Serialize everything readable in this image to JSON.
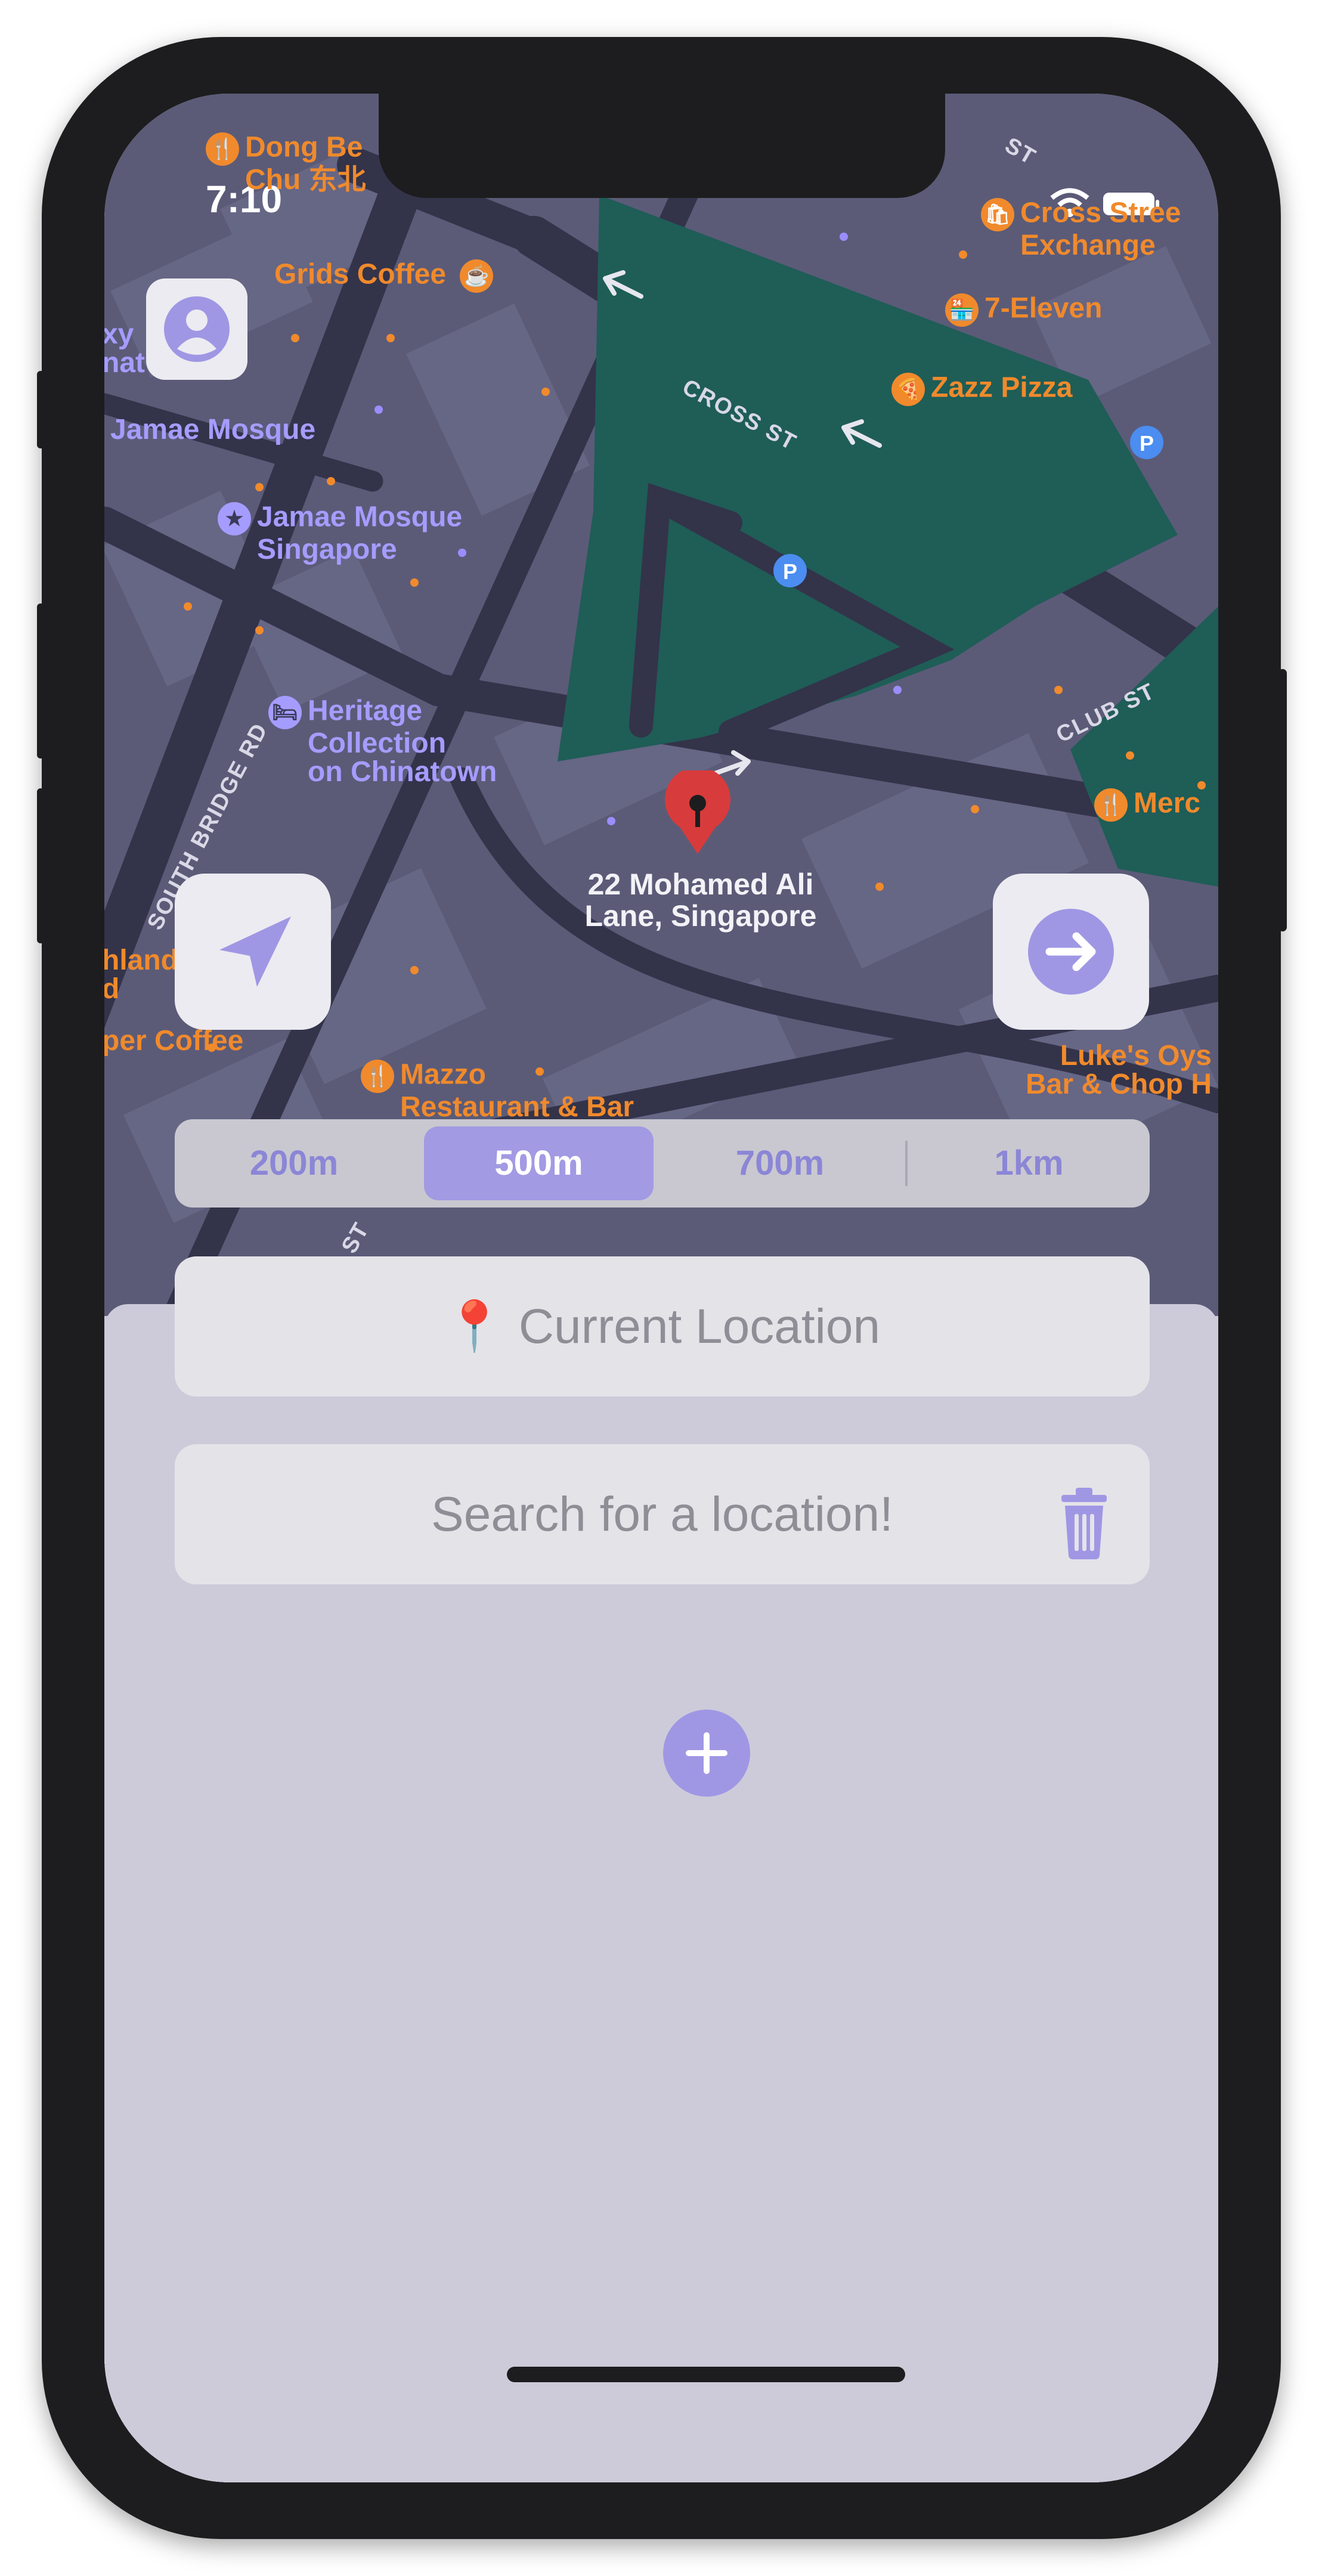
{
  "status_bar": {
    "time": "7:10"
  },
  "map": {
    "pin_label_line1": "22 Mohamed Ali",
    "pin_label_line2": "Lane, Singapore",
    "pois": {
      "dong_bei_1": "Dong Be",
      "dong_bei_2": "Chu 东北",
      "grids_coffee": "Grids Coffee",
      "jamae_mosque": "Jamae Mosque",
      "jamae_mosque_sg_1": "Jamae Mosque",
      "jamae_mosque_sg_2": "Singapore",
      "heritage_1": "Heritage",
      "heritage_2": "Collection",
      "heritage_3": "on Chinatown",
      "cross_street_1": "Cross Stree",
      "cross_street_2": "Exchange",
      "seven_eleven": "7-Eleven",
      "zazz_pizza": "Zazz Pizza",
      "merc": "Merc",
      "lukes_1": "Luke's Oys",
      "lukes_2": "Bar & Chop H",
      "mazzo_1": "Mazzo",
      "mazzo_2": "Restaurant & Bar",
      "kopi_coffee": "per Coffee",
      "highland_1": "hland",
      "highland_2": "d",
      "sky_1": "xy",
      "sky_2": "nat"
    },
    "streets": {
      "cross_st": "CROSS ST",
      "club_st": "CLUB ST",
      "south_bridge": "SOUTH BRIDGE RD",
      "st_top": "ST",
      "st_bottom": "ST"
    }
  },
  "radius_selector": {
    "options": [
      "200m",
      "500m",
      "700m",
      "1km"
    ],
    "selected": "500m"
  },
  "current_location": {
    "icon": "📍",
    "label": "Current Location"
  },
  "search": {
    "placeholder": "Search for a location!"
  },
  "colors": {
    "accent": "#9f97e4",
    "sheet_bg": "#cdcbd9",
    "field_bg": "#e4e3e8",
    "map_bg": "#5b5b78",
    "park": "#1f5d57",
    "pin": "#d83b3b"
  },
  "icons": {
    "avatar": "person-circle-icon",
    "locate": "paper-plane-icon",
    "go": "arrow-right-circle-icon",
    "trash": "trash-icon",
    "add": "plus-circle-icon"
  }
}
